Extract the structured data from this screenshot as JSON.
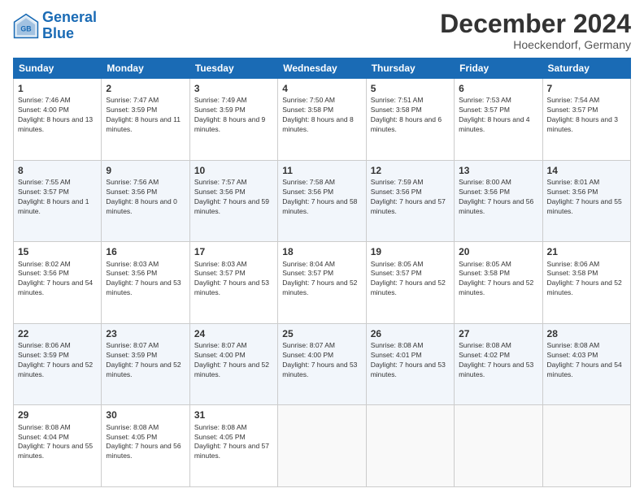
{
  "logo": {
    "line1": "General",
    "line2": "Blue"
  },
  "title": "December 2024",
  "location": "Hoeckendorf, Germany",
  "weekdays": [
    "Sunday",
    "Monday",
    "Tuesday",
    "Wednesday",
    "Thursday",
    "Friday",
    "Saturday"
  ],
  "weeks": [
    [
      {
        "day": "1",
        "sunrise": "7:46 AM",
        "sunset": "4:00 PM",
        "daylight": "8 hours and 13 minutes."
      },
      {
        "day": "2",
        "sunrise": "7:47 AM",
        "sunset": "3:59 PM",
        "daylight": "8 hours and 11 minutes."
      },
      {
        "day": "3",
        "sunrise": "7:49 AM",
        "sunset": "3:59 PM",
        "daylight": "8 hours and 9 minutes."
      },
      {
        "day": "4",
        "sunrise": "7:50 AM",
        "sunset": "3:58 PM",
        "daylight": "8 hours and 8 minutes."
      },
      {
        "day": "5",
        "sunrise": "7:51 AM",
        "sunset": "3:58 PM",
        "daylight": "8 hours and 6 minutes."
      },
      {
        "day": "6",
        "sunrise": "7:53 AM",
        "sunset": "3:57 PM",
        "daylight": "8 hours and 4 minutes."
      },
      {
        "day": "7",
        "sunrise": "7:54 AM",
        "sunset": "3:57 PM",
        "daylight": "8 hours and 3 minutes."
      }
    ],
    [
      {
        "day": "8",
        "sunrise": "7:55 AM",
        "sunset": "3:57 PM",
        "daylight": "8 hours and 1 minute."
      },
      {
        "day": "9",
        "sunrise": "7:56 AM",
        "sunset": "3:56 PM",
        "daylight": "8 hours and 0 minutes."
      },
      {
        "day": "10",
        "sunrise": "7:57 AM",
        "sunset": "3:56 PM",
        "daylight": "7 hours and 59 minutes."
      },
      {
        "day": "11",
        "sunrise": "7:58 AM",
        "sunset": "3:56 PM",
        "daylight": "7 hours and 58 minutes."
      },
      {
        "day": "12",
        "sunrise": "7:59 AM",
        "sunset": "3:56 PM",
        "daylight": "7 hours and 57 minutes."
      },
      {
        "day": "13",
        "sunrise": "8:00 AM",
        "sunset": "3:56 PM",
        "daylight": "7 hours and 56 minutes."
      },
      {
        "day": "14",
        "sunrise": "8:01 AM",
        "sunset": "3:56 PM",
        "daylight": "7 hours and 55 minutes."
      }
    ],
    [
      {
        "day": "15",
        "sunrise": "8:02 AM",
        "sunset": "3:56 PM",
        "daylight": "7 hours and 54 minutes."
      },
      {
        "day": "16",
        "sunrise": "8:03 AM",
        "sunset": "3:56 PM",
        "daylight": "7 hours and 53 minutes."
      },
      {
        "day": "17",
        "sunrise": "8:03 AM",
        "sunset": "3:57 PM",
        "daylight": "7 hours and 53 minutes."
      },
      {
        "day": "18",
        "sunrise": "8:04 AM",
        "sunset": "3:57 PM",
        "daylight": "7 hours and 52 minutes."
      },
      {
        "day": "19",
        "sunrise": "8:05 AM",
        "sunset": "3:57 PM",
        "daylight": "7 hours and 52 minutes."
      },
      {
        "day": "20",
        "sunrise": "8:05 AM",
        "sunset": "3:58 PM",
        "daylight": "7 hours and 52 minutes."
      },
      {
        "day": "21",
        "sunrise": "8:06 AM",
        "sunset": "3:58 PM",
        "daylight": "7 hours and 52 minutes."
      }
    ],
    [
      {
        "day": "22",
        "sunrise": "8:06 AM",
        "sunset": "3:59 PM",
        "daylight": "7 hours and 52 minutes."
      },
      {
        "day": "23",
        "sunrise": "8:07 AM",
        "sunset": "3:59 PM",
        "daylight": "7 hours and 52 minutes."
      },
      {
        "day": "24",
        "sunrise": "8:07 AM",
        "sunset": "4:00 PM",
        "daylight": "7 hours and 52 minutes."
      },
      {
        "day": "25",
        "sunrise": "8:07 AM",
        "sunset": "4:00 PM",
        "daylight": "7 hours and 53 minutes."
      },
      {
        "day": "26",
        "sunrise": "8:08 AM",
        "sunset": "4:01 PM",
        "daylight": "7 hours and 53 minutes."
      },
      {
        "day": "27",
        "sunrise": "8:08 AM",
        "sunset": "4:02 PM",
        "daylight": "7 hours and 53 minutes."
      },
      {
        "day": "28",
        "sunrise": "8:08 AM",
        "sunset": "4:03 PM",
        "daylight": "7 hours and 54 minutes."
      }
    ],
    [
      {
        "day": "29",
        "sunrise": "8:08 AM",
        "sunset": "4:04 PM",
        "daylight": "7 hours and 55 minutes."
      },
      {
        "day": "30",
        "sunrise": "8:08 AM",
        "sunset": "4:05 PM",
        "daylight": "7 hours and 56 minutes."
      },
      {
        "day": "31",
        "sunrise": "8:08 AM",
        "sunset": "4:05 PM",
        "daylight": "7 hours and 57 minutes."
      },
      null,
      null,
      null,
      null
    ]
  ]
}
